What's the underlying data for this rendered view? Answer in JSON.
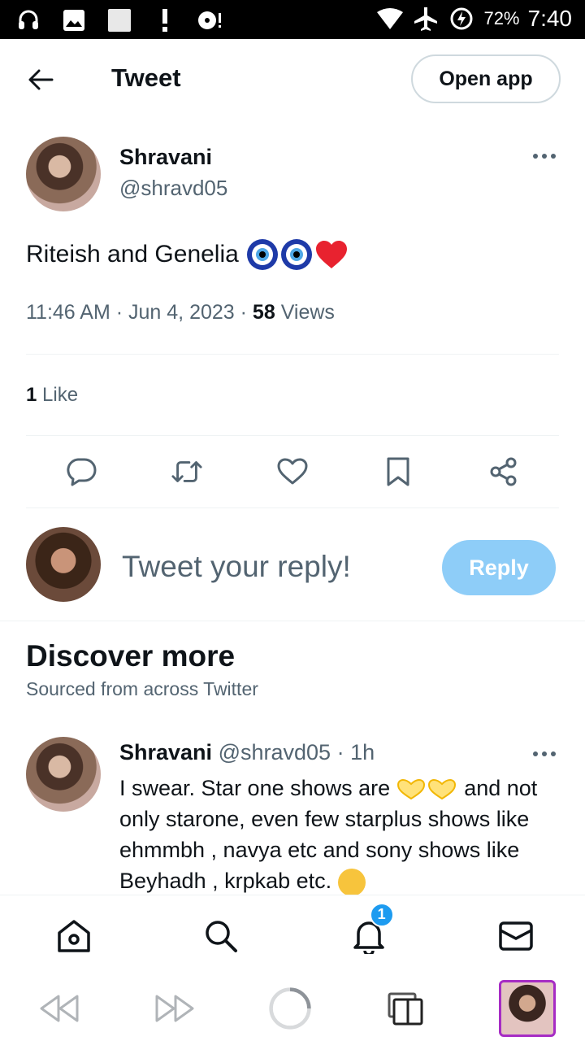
{
  "status_bar": {
    "battery": "72%",
    "time": "7:40"
  },
  "header": {
    "title": "Tweet",
    "open_app": "Open app"
  },
  "tweet": {
    "author_name": "Shravani",
    "author_handle": "@shravd05",
    "text": "Riteish and Genelia",
    "time": "11:46 AM",
    "date": "Jun 4, 2023",
    "views_count": "58",
    "views_label": "Views",
    "likes_count": "1",
    "likes_label": "Like"
  },
  "reply": {
    "placeholder": "Tweet your reply!",
    "button": "Reply"
  },
  "discover": {
    "title": "Discover more",
    "subtitle": "Sourced from across Twitter"
  },
  "post": {
    "author_name": "Shravani",
    "author_handle": "@shravd05",
    "age": "1h",
    "text_1": "I swear.  Star one shows are",
    "text_2": "and not only starone, even few starplus shows like ehmmbh , navya etc and sony shows like Beyhadh , krpkab etc."
  },
  "nav": {
    "notifications_badge": "1"
  },
  "colors": {
    "accent": "#1d9bf0",
    "reply_button": "#8ecdf8",
    "secondary_text": "#536471"
  }
}
